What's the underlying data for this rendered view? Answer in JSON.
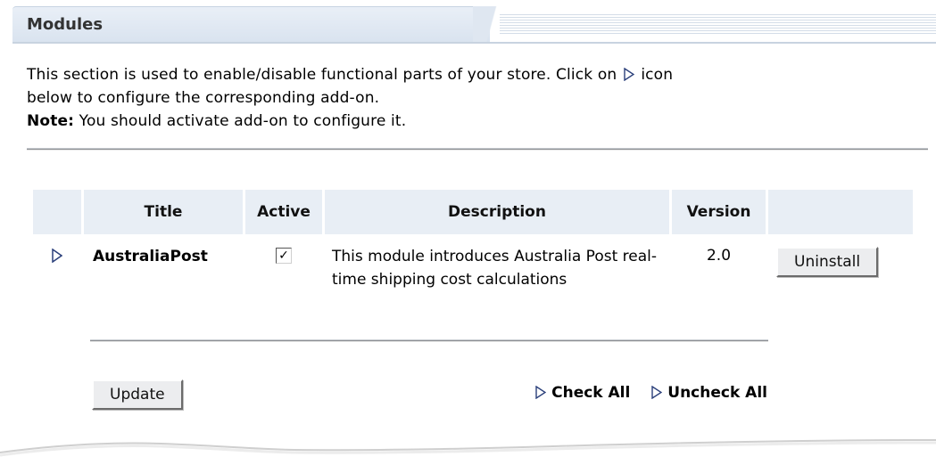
{
  "panel": {
    "title": "Modules",
    "intro_line1": "This section is used to enable/disable functional parts of your store. Click on",
    "intro_icon_suffix": "icon",
    "intro_line2": "below to configure the corresponding add-on.",
    "note_label": "Note:",
    "note_text": " You should activate add-on to configure it."
  },
  "table": {
    "headers": [
      "",
      "Title",
      "Active",
      "Description",
      "Version",
      ""
    ],
    "rows": [
      {
        "title": "AustraliaPost",
        "active": true,
        "active_mark": "✓",
        "description": "This module introduces Australia Post real-time shipping cost calculations",
        "version": "2.0",
        "action_label": "Uninstall"
      }
    ]
  },
  "footer": {
    "update_label": "Update",
    "check_all_label": "Check All",
    "uncheck_all_label": "Uncheck All"
  },
  "colors": {
    "header_bg": "#e8eef5",
    "button_bg": "#ecedef",
    "arrow_fill": "#ffffff",
    "arrow_stroke": "#2a3f7a"
  },
  "icons": {
    "configure": "triangle-right-icon"
  }
}
